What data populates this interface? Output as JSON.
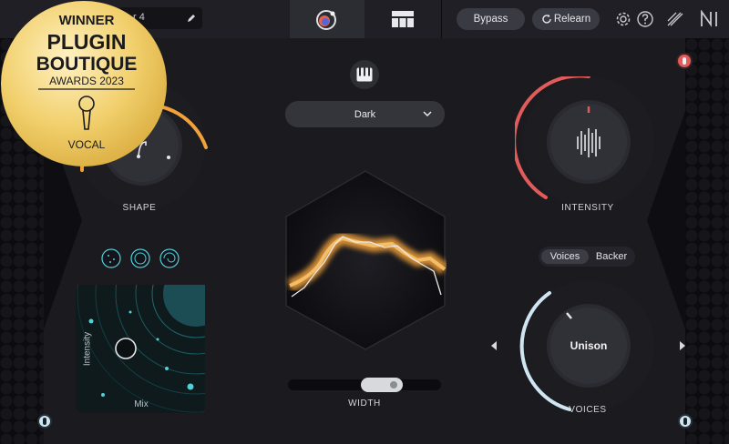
{
  "header": {
    "preset_name": "r 4",
    "bypass_label": "Bypass",
    "relearn_label": "Relearn"
  },
  "badge": {
    "line1": "WINNER",
    "line2": "PLUGIN",
    "line3": "BOUTIQUE",
    "line4": "AWARDS 2023",
    "line5": "VOCAL"
  },
  "shape": {
    "label": "SHAPE"
  },
  "intensity": {
    "label": "INTENSITY"
  },
  "style_select": {
    "value": "Dark"
  },
  "width": {
    "label": "WIDTH",
    "level": 0.7
  },
  "voices": {
    "label": "VOICES",
    "value": "Unison",
    "tabs": [
      "Voices",
      "Backer"
    ],
    "active_tab": "Voices"
  },
  "xy_pad": {
    "x_label": "Mix",
    "y_label": "Intensity"
  },
  "colors": {
    "accent_orange": "#f2a03a",
    "accent_red": "#e25b5b",
    "accent_teal": "#4fd1d9",
    "accent_ice": "#cfe6f2"
  }
}
